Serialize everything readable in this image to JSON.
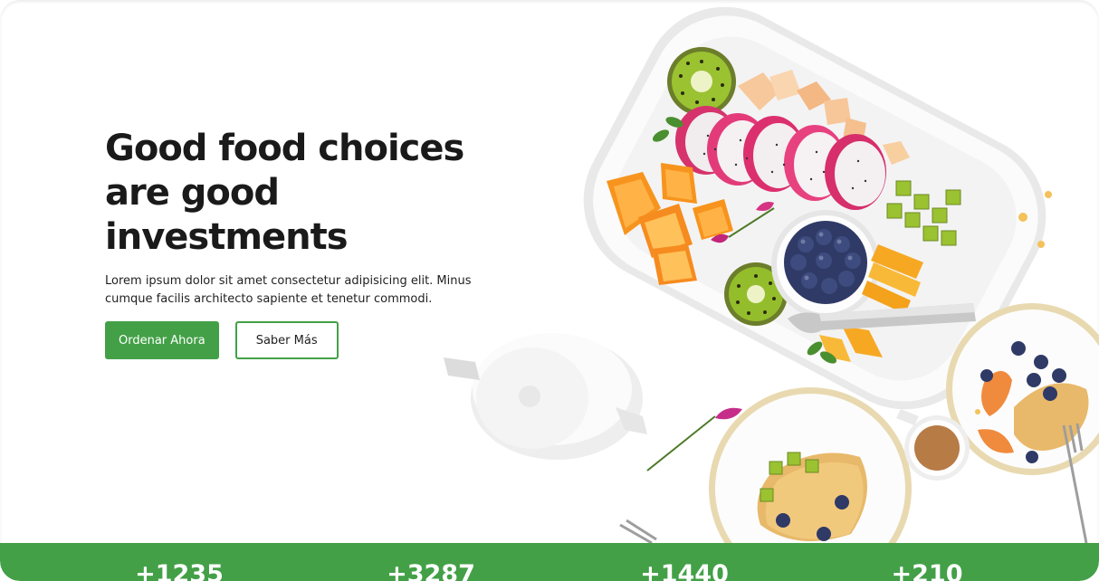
{
  "hero": {
    "title": "Good food choices are good investments",
    "description": "Lorem ipsum dolor sit amet consectetur adipisicing elit. Minus cumque facilis architecto sapiente et tenetur commodi.",
    "primary_button": "Ordenar Ahora",
    "secondary_button": "Saber Más"
  },
  "stats": {
    "items": [
      {
        "value": "+1235"
      },
      {
        "value": "+3287"
      },
      {
        "value": "+1440"
      },
      {
        "value": "+210"
      }
    ]
  },
  "colors": {
    "accent": "#43a047",
    "text": "#1a1a1a",
    "background": "#ffffff"
  },
  "image": {
    "icon": "food-platter-image"
  }
}
